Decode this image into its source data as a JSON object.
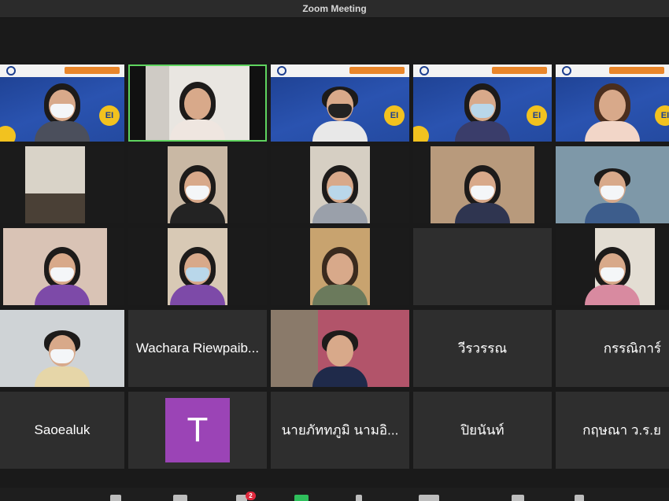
{
  "window": {
    "title": "Zoom Meeting"
  },
  "participants": {
    "wachara": "Wachara Riewpaib...",
    "weerawan": "วีรวรรณ",
    "kronnika": "กรรณิการ์",
    "saoealuk": "Saoealuk",
    "avatar_letter": "T",
    "nayphat": "นายภัททภูมิ  นามอิ...",
    "piyanan": "ปิยนันท์",
    "kritsana": "กฤษณา ว.ร.ย"
  },
  "banner": {
    "sun_label": "EI"
  },
  "toolbar": {
    "chat_badge": "2"
  },
  "colors": {
    "active_speaker_border": "#5fd45f",
    "avatar_bg": "#9b44b6",
    "badge_red": "#e0293d",
    "tile_bg": "#2e2e2e"
  },
  "icons": [
    "mute-icon",
    "participants-icon",
    "chat-icon",
    "share-screen-icon",
    "record-icon",
    "reactions-icon",
    "apps-icon",
    "more-icon"
  ]
}
